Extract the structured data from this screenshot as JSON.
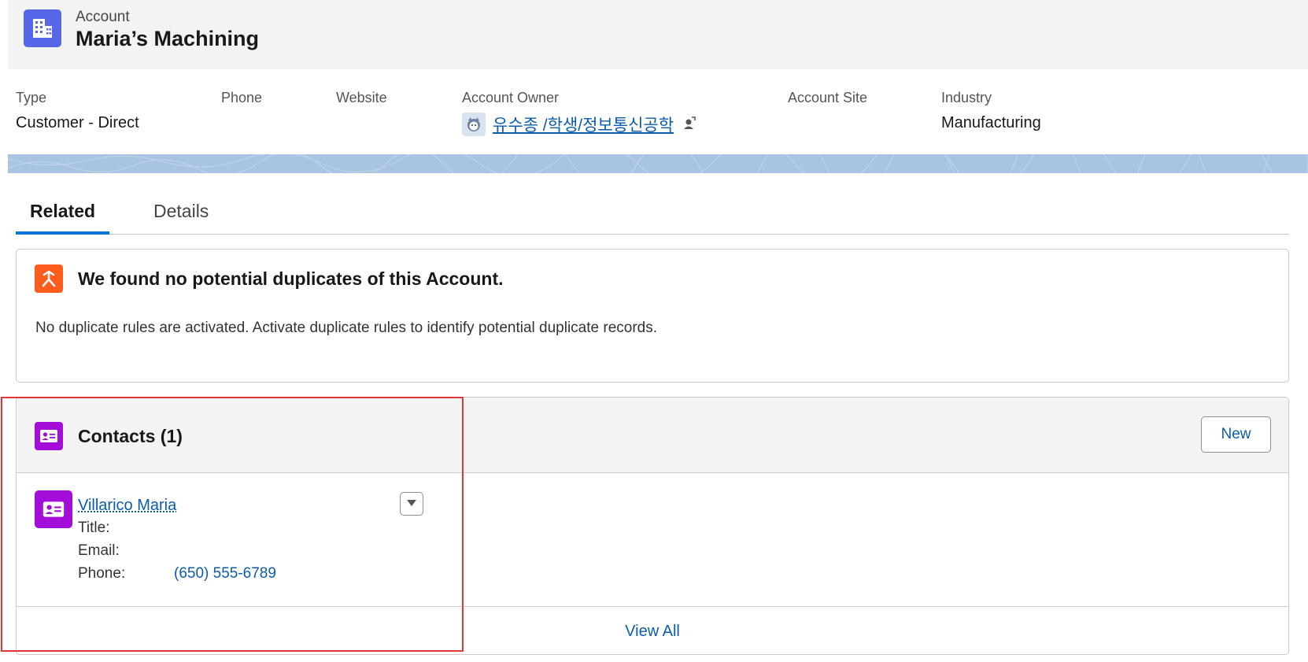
{
  "header": {
    "object_label": "Account",
    "record_title": "Maria’s Machining",
    "icon": "building-icon",
    "icon_color": "#5867e8"
  },
  "highlights": {
    "type_label": "Type",
    "type_value": "Customer - Direct",
    "phone_label": "Phone",
    "website_label": "Website",
    "owner_label": "Account Owner",
    "owner_value": "유수종 /학생/정보통신공학",
    "site_label": "Account Site",
    "industry_label": "Industry",
    "industry_value": "Manufacturing"
  },
  "tabs": [
    {
      "label": "Related",
      "active": true
    },
    {
      "label": "Details",
      "active": false
    }
  ],
  "duplicates": {
    "title": "We found no potential duplicates of this Account.",
    "message": "No duplicate rules are activated. Activate duplicate rules to identify potential duplicate records.",
    "icon": "merge-icon",
    "icon_color": "#fe5c1d"
  },
  "contacts": {
    "title": "Contacts (1)",
    "new_label": "New",
    "icon": "contact-card-icon",
    "icon_color": "#a20dd8",
    "items": [
      {
        "name": "Villarico Maria",
        "title_label": "Title:",
        "email_label": "Email:",
        "phone_label": "Phone:",
        "phone_value": "(650) 555-6789"
      }
    ],
    "view_all_label": "View All"
  },
  "colors": {
    "link": "#0b5cab",
    "active_tab": "#0176d3",
    "highlight_box": "#e03838"
  }
}
